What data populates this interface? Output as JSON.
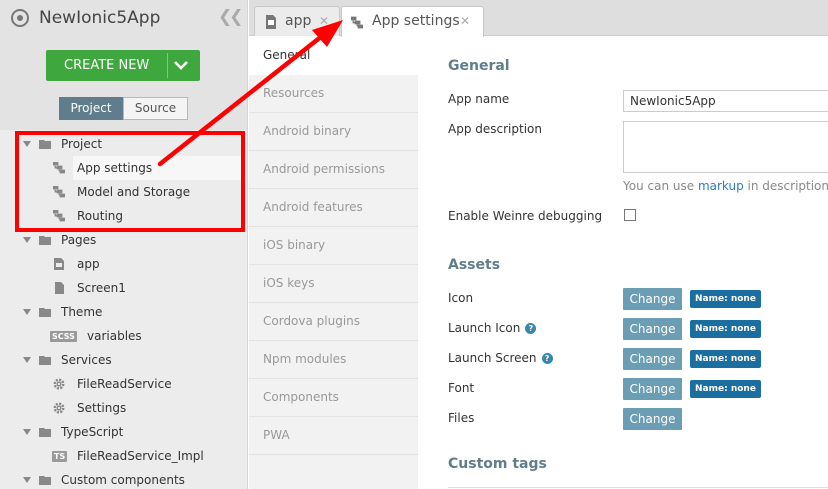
{
  "app": {
    "title": "NewIonic5App",
    "create_label": "CREATE NEW"
  },
  "sidebar": {
    "toggle": [
      "Project",
      "Source"
    ],
    "tree": [
      {
        "label": "Project",
        "kind": "folder",
        "level": 0
      },
      {
        "label": "App settings",
        "kind": "settings-file",
        "level": 1,
        "selected": true
      },
      {
        "label": "Model and Storage",
        "kind": "settings-file",
        "level": 1
      },
      {
        "label": "Routing",
        "kind": "settings-file",
        "level": 1
      },
      {
        "label": "Pages",
        "kind": "folder",
        "level": 0
      },
      {
        "label": "app",
        "kind": "page-file",
        "level": 1
      },
      {
        "label": "Screen1",
        "kind": "file",
        "level": 1
      },
      {
        "label": "Theme",
        "kind": "folder",
        "level": 0
      },
      {
        "label": "variables",
        "kind": "scss-file",
        "badge": "SCSS",
        "level": 1
      },
      {
        "label": "Services",
        "kind": "folder",
        "level": 0
      },
      {
        "label": "FileReadService",
        "kind": "gear",
        "level": 1
      },
      {
        "label": "Settings",
        "kind": "gear",
        "level": 1
      },
      {
        "label": "TypeScript",
        "kind": "folder",
        "level": 0
      },
      {
        "label": "FileReadService_Impl",
        "kind": "ts-file",
        "badge": "TS",
        "level": 1
      },
      {
        "label": "Custom components",
        "kind": "folder",
        "level": 0
      }
    ]
  },
  "tabs": [
    {
      "label": "app",
      "active": false
    },
    {
      "label": "App settings",
      "active": true
    }
  ],
  "settings_nav": [
    {
      "label": "General",
      "active": true
    },
    {
      "label": "Resources"
    },
    {
      "label": "Android binary"
    },
    {
      "label": "Android permissions"
    },
    {
      "label": "Android features"
    },
    {
      "label": "iOS binary"
    },
    {
      "label": "iOS keys"
    },
    {
      "label": "Cordova plugins"
    },
    {
      "label": "Npm modules"
    },
    {
      "label": "Components"
    },
    {
      "label": "PWA"
    }
  ],
  "general": {
    "title": "General",
    "app_name_label": "App name",
    "app_name_value": "NewIonic5App",
    "app_desc_label": "App description",
    "app_desc_value": "",
    "desc_hint_before": "You can use ",
    "desc_hint_link": "markup",
    "desc_hint_after": " in description.",
    "weinre_label": "Enable Weinre debugging"
  },
  "assets": {
    "title": "Assets",
    "rows": [
      {
        "label": "Icon",
        "button": "Change",
        "badge": "Name: none",
        "help": false
      },
      {
        "label": "Launch Icon",
        "button": "Change",
        "badge": "Name: none",
        "help": true
      },
      {
        "label": "Launch Screen",
        "button": "Change",
        "badge": "Name: none",
        "help": true
      },
      {
        "label": "Font",
        "button": "Change",
        "badge": "Name: none",
        "help": false
      },
      {
        "label": "Files",
        "button": "Change",
        "badge": "",
        "help": false
      }
    ]
  },
  "custom_tags": {
    "title": "Custom tags"
  },
  "colors": {
    "create_green": "#3ea83e",
    "accent_slate": "#607d8b",
    "annotation_red": "#ff0000",
    "badge_blue": "#1a6fa0"
  }
}
